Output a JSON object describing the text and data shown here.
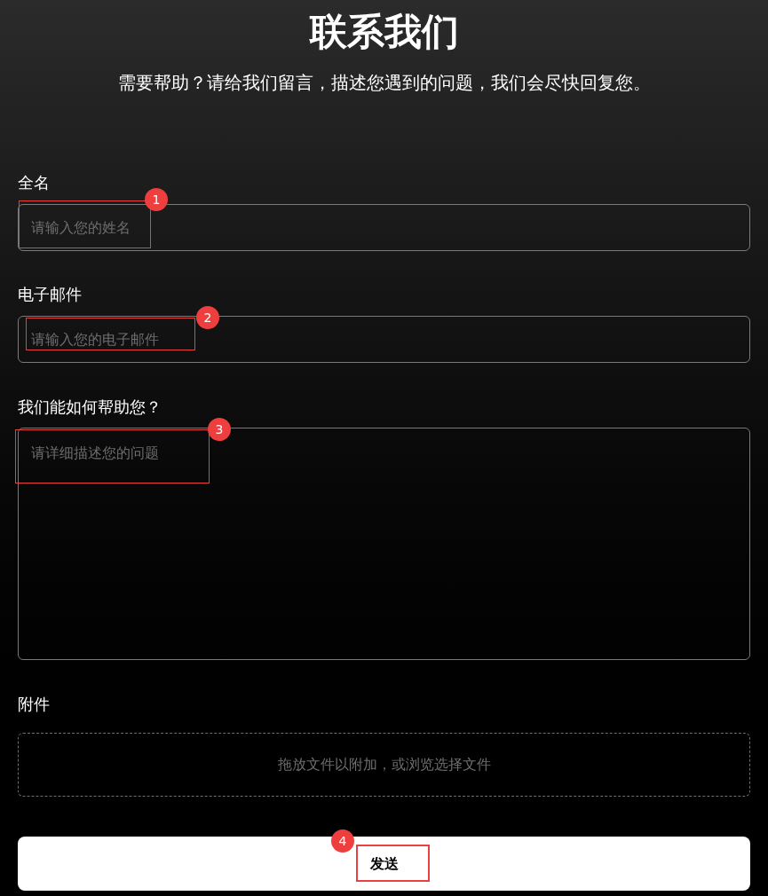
{
  "title": "联系我们",
  "subtitle": "需要帮助？请给我们留言，描述您遇到的问题，我们会尽快回复您。",
  "fields": [
    {
      "kind": "input",
      "label": "全名",
      "placeholder": "请输入您的姓名"
    },
    {
      "kind": "input",
      "label": "电子邮件",
      "placeholder": "请输入您的电子邮件"
    },
    {
      "kind": "textarea",
      "label": "我们能如何帮助您？",
      "placeholder": "请详细描述您的问题"
    },
    {
      "kind": "dropzone",
      "label": "附件",
      "placeholder": "拖放文件以附加，或浏览选择文件"
    }
  ],
  "submit_button": "发送",
  "annotations": [
    {
      "number": "1"
    },
    {
      "number": "2"
    },
    {
      "number": "3"
    },
    {
      "number": "4"
    }
  ]
}
